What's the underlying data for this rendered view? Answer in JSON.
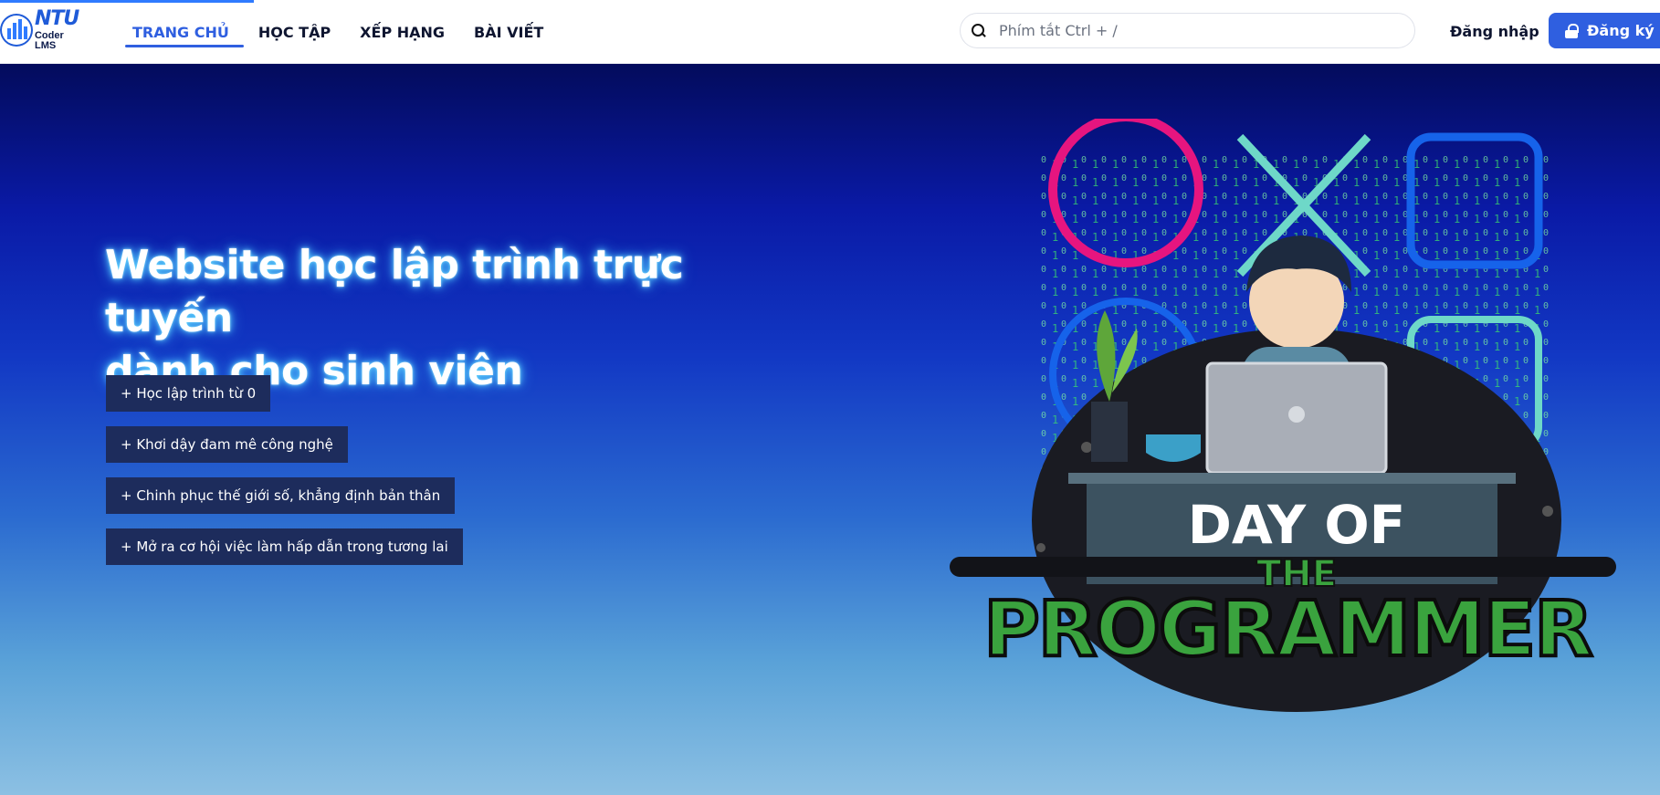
{
  "header": {
    "logo_text": "NTU",
    "logo_subtitle": "Coder LMS",
    "nav": [
      {
        "label": "TRANG CHỦ",
        "active": true
      },
      {
        "label": "HỌC TẬP",
        "active": false
      },
      {
        "label": "XẾP HẠNG",
        "active": false
      },
      {
        "label": "BÀI VIẾT",
        "active": false
      }
    ],
    "search_placeholder": "Phím tắt Ctrl + /",
    "login_label": "Đăng nhập",
    "register_label": "Đăng ký"
  },
  "hero": {
    "title_line1": "Website học lập trình trực tuyến",
    "title_line2": "dành cho sinh viên",
    "features": [
      "+ Học lập trình từ 0",
      "+ Khơi dậy đam mê công nghệ",
      "+ Chinh phục thế giới số, khẳng định bản thân",
      "+ Mở ra cơ hội việc làm hấp dẫn trong tương lai"
    ],
    "illustration": {
      "line1": "DAY OF",
      "line2": "THE",
      "line3": "PROGRAMMER"
    }
  },
  "colors": {
    "accent": "#2f5fe0",
    "hero_top": "#030b5c",
    "hero_bottom": "#8cc0e3",
    "feature_bg": "#1d2c5c"
  }
}
